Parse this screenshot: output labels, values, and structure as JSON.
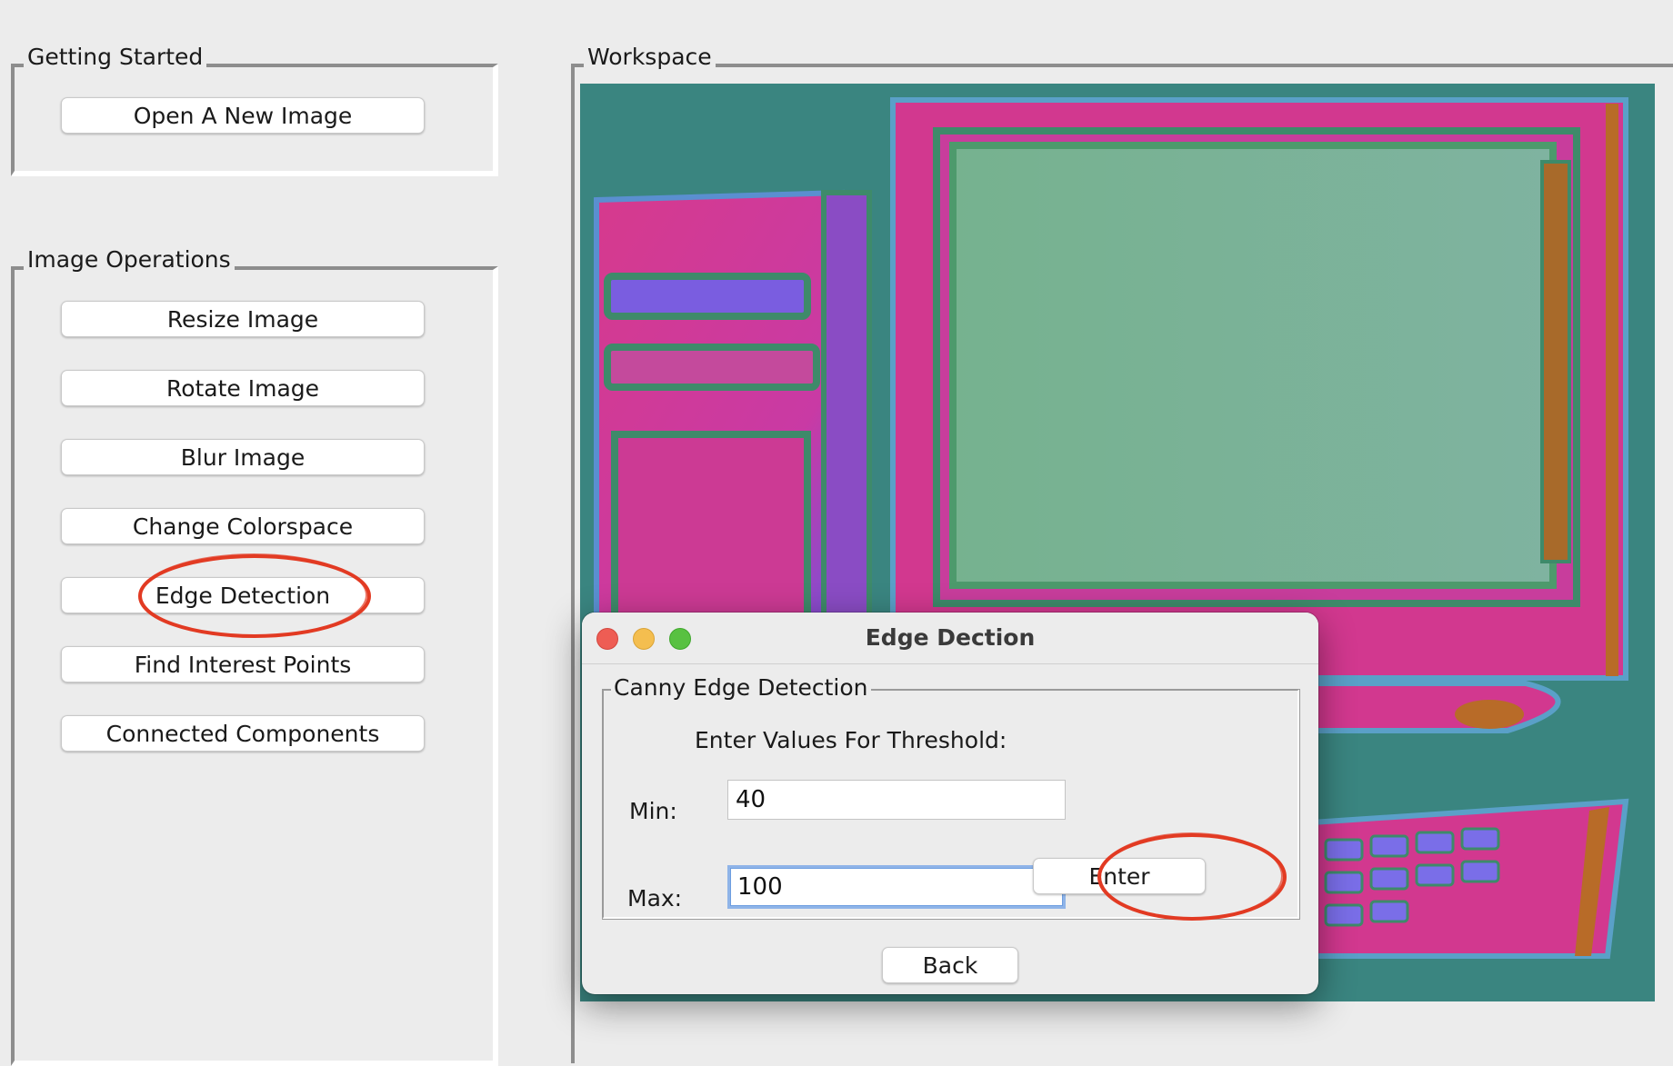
{
  "getting_started": {
    "title": "Getting Started",
    "open_button": "Open A New Image"
  },
  "image_operations": {
    "title": "Image Operations",
    "buttons": [
      "Resize Image",
      "Rotate Image",
      "Blur Image",
      "Change Colorspace",
      "Edge Detection",
      "Find Interest Points",
      "Connected Components"
    ]
  },
  "workspace": {
    "title": "Workspace",
    "image_icon": "computer-illustration-image"
  },
  "dialog": {
    "title": "Edge Dection",
    "group_title": "Canny Edge Detection",
    "instruction": "Enter Values For Threshold:",
    "min_label": "Min:",
    "min_value": "40",
    "max_label": "Max:",
    "max_value": "100",
    "enter_button": "Enter",
    "back_button": "Back"
  },
  "colors": {
    "annotation": "#e23b23",
    "image_background": "#3a8580",
    "image_magenta": "#d2388f",
    "image_screen": "#7ab595"
  }
}
